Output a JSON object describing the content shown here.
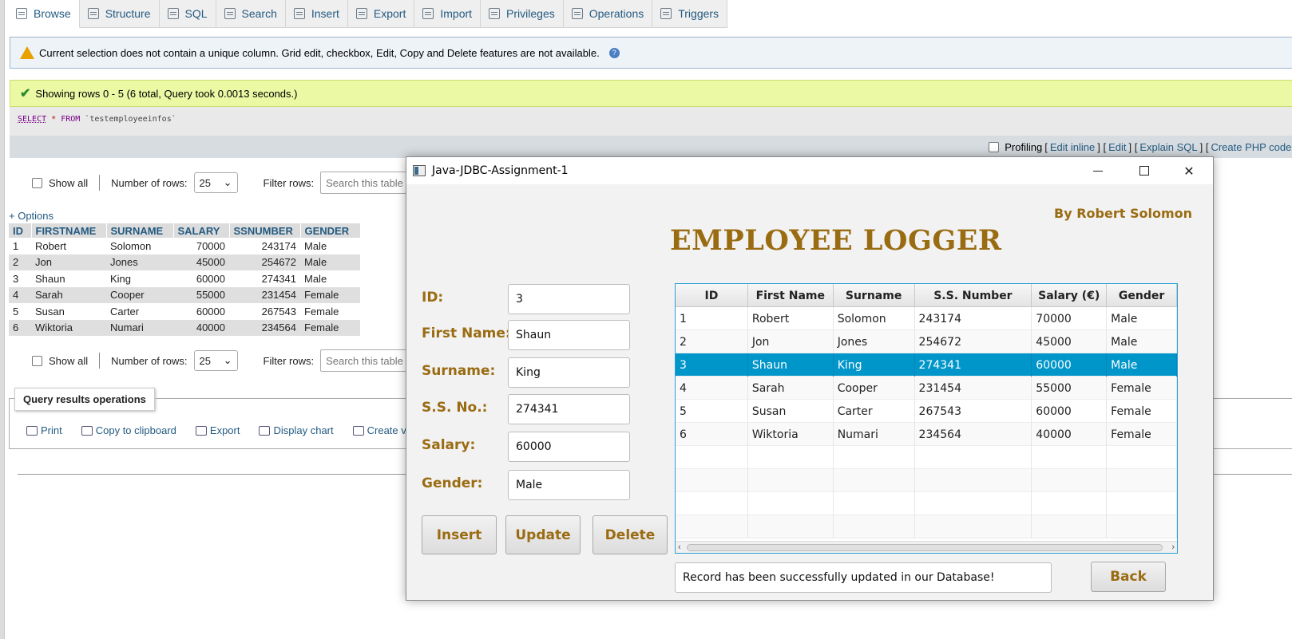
{
  "tabs": [
    {
      "label": "Browse",
      "icon": "browse-icon"
    },
    {
      "label": "Structure",
      "icon": "structure-icon"
    },
    {
      "label": "SQL",
      "icon": "sql-icon"
    },
    {
      "label": "Search",
      "icon": "search-icon"
    },
    {
      "label": "Insert",
      "icon": "insert-icon"
    },
    {
      "label": "Export",
      "icon": "export-icon"
    },
    {
      "label": "Import",
      "icon": "import-icon"
    },
    {
      "label": "Privileges",
      "icon": "privileges-icon"
    },
    {
      "label": "Operations",
      "icon": "wrench-icon"
    },
    {
      "label": "Triggers",
      "icon": "triggers-icon"
    }
  ],
  "notice": {
    "text": "Current selection does not contain a unique column. Grid edit, checkbox, Edit, Copy and Delete features are not available."
  },
  "success": {
    "text": "Showing rows 0 - 5 (6 total, Query took 0.0013 seconds.)"
  },
  "sql": {
    "select": "SELECT",
    "star": "*",
    "from": "FROM",
    "table": "`testemployeeinfos`"
  },
  "sqlbar": {
    "profiling": "Profiling",
    "edit_inline": "Edit inline",
    "edit": "Edit",
    "explain": "Explain SQL",
    "php": "Create PHP code"
  },
  "rowcontrols": {
    "show_all": "Show all",
    "rows_label": "Number of rows:",
    "rows_value": "25",
    "filter_label": "Filter rows:",
    "filter_placeholder": "Search this table"
  },
  "options_link": "+ Options",
  "pma_table": {
    "headers": [
      "ID",
      "FIRSTNAME",
      "SURNAME",
      "SALARY",
      "SSNUMBER",
      "GENDER"
    ],
    "rows": [
      [
        "1",
        "Robert",
        "Solomon",
        "70000",
        "243174",
        "Male"
      ],
      [
        "2",
        "Jon",
        "Jones",
        "45000",
        "254672",
        "Male"
      ],
      [
        "3",
        "Shaun",
        "King",
        "60000",
        "274341",
        "Male"
      ],
      [
        "4",
        "Sarah",
        "Cooper",
        "55000",
        "231454",
        "Female"
      ],
      [
        "5",
        "Susan",
        "Carter",
        "60000",
        "267543",
        "Female"
      ],
      [
        "6",
        "Wiktoria",
        "Numari",
        "40000",
        "234564",
        "Female"
      ]
    ]
  },
  "qro": {
    "title": "Query results operations",
    "links": [
      "Print",
      "Copy to clipboard",
      "Export",
      "Display chart",
      "Create v"
    ]
  },
  "java_window": {
    "title": "Java-JDBC-Assignment-1",
    "author": "By Robert Solomon",
    "heading": "EMPLOYEE LOGGER",
    "fields": [
      {
        "label": "ID:",
        "value": "3"
      },
      {
        "label": "First Name:",
        "value": "Shaun"
      },
      {
        "label": "Surname:",
        "value": "King"
      },
      {
        "label": "S.S. No.:",
        "value": "274341"
      },
      {
        "label": "Salary:",
        "value": "60000"
      },
      {
        "label": "Gender:",
        "value": "Male"
      }
    ],
    "buttons": {
      "insert": "Insert",
      "update": "Update",
      "delete": "Delete",
      "back": "Back"
    },
    "table": {
      "headers": [
        "ID",
        "First Name",
        "Surname",
        "S.S. Number",
        "Salary (€)",
        "Gender"
      ],
      "rows": [
        [
          "1",
          "Robert",
          "Solomon",
          "243174",
          "70000",
          "Male"
        ],
        [
          "2",
          "Jon",
          "Jones",
          "254672",
          "45000",
          "Male"
        ],
        [
          "3",
          "Shaun",
          "King",
          "274341",
          "60000",
          "Male"
        ],
        [
          "4",
          "Sarah",
          "Cooper",
          "231454",
          "55000",
          "Female"
        ],
        [
          "5",
          "Susan",
          "Carter",
          "267543",
          "60000",
          "Female"
        ],
        [
          "6",
          "Wiktoria",
          "Numari",
          "234564",
          "40000",
          "Female"
        ]
      ],
      "selected_row": 2
    },
    "status": "Record has been successfully updated in our Database!",
    "accent_color": "#9a6c12",
    "selection_color": "#0096c9"
  }
}
